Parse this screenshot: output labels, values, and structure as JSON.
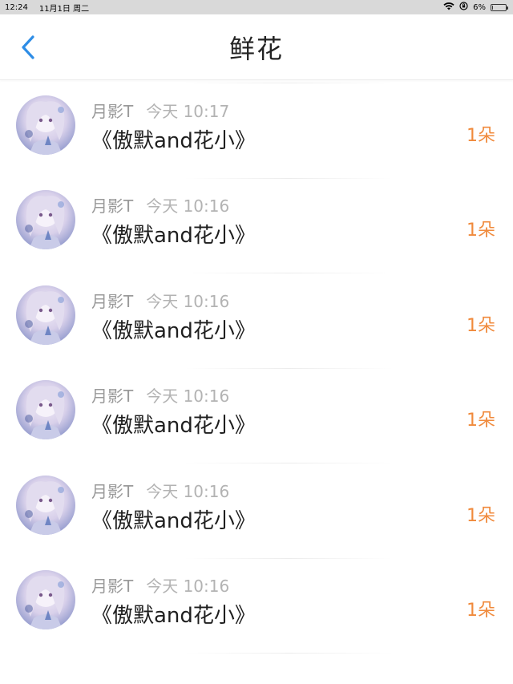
{
  "status_bar": {
    "time": "12:24",
    "date": "11月1日 周二",
    "battery_pct": "6%",
    "battery_level": 0.06
  },
  "nav": {
    "title": "鲜花",
    "back_icon": "chevron-left-icon",
    "accent_color": "#2e8de6"
  },
  "gifts": [
    {
      "user": "月影T",
      "time": "",
      "title": "《傲默and花小》",
      "amount": "1朵"
    },
    {
      "user": "月影T",
      "time": "今天 10:17",
      "title": "《傲默and花小》",
      "amount": "1朵"
    },
    {
      "user": "月影T",
      "time": "今天 10:16",
      "title": "《傲默and花小》",
      "amount": "1朵"
    },
    {
      "user": "月影T",
      "time": "今天 10:16",
      "title": "《傲默and花小》",
      "amount": "1朵"
    },
    {
      "user": "月影T",
      "time": "今天 10:16",
      "title": "《傲默and花小》",
      "amount": "1朵"
    },
    {
      "user": "月影T",
      "time": "今天 10:16",
      "title": "《傲默and花小》",
      "amount": "1朵"
    },
    {
      "user": "月影T",
      "time": "今天 10:16",
      "title": "《傲默and花小》",
      "amount": "1朵"
    }
  ],
  "colors": {
    "amount": "#f08a3c",
    "meta": "#9a9a9a"
  }
}
